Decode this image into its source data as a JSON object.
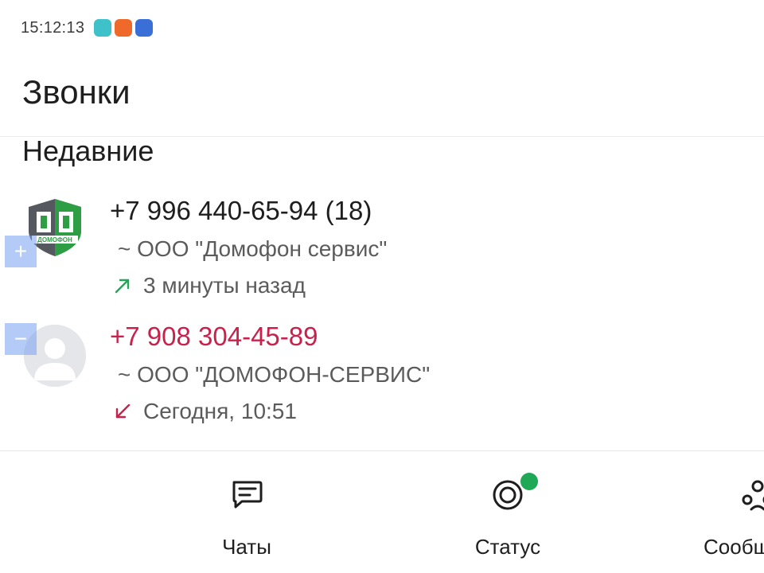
{
  "status_bar": {
    "time": "15:12:13",
    "icons": [
      "app-icon-teal",
      "app-icon-orange",
      "app-icon-blue"
    ]
  },
  "header": {
    "title": "Звонки",
    "section_title": "Недавние"
  },
  "calls": [
    {
      "number": "+7 996 440-65-94 (18)",
      "contact": "~ ООО \"Домофон сервис\"",
      "time": "3 минуты назад",
      "direction": "outgoing",
      "avatar_logo_text": "ДОМОФОН",
      "select_toggle": "+"
    },
    {
      "number": "+7 908 304-45-89",
      "contact": "~ ООО \"ДОМОФОН-СЕРВИС\"",
      "time": "Сегодня, 10:51",
      "direction": "missed",
      "select_toggle": "−"
    }
  ],
  "bottom_nav": [
    {
      "label": "Чаты",
      "icon": "chat-icon"
    },
    {
      "label": "Статус",
      "icon": "status-icon",
      "has_update_dot": true
    },
    {
      "label": "Сообщ",
      "icon": "community-icon"
    }
  ],
  "colors": {
    "missed": "#c8224c",
    "outgoing_arrow": "#1fa855",
    "status_dot": "#1fa855",
    "logo_green": "#2e9e44",
    "logo_gray": "#55595f"
  }
}
